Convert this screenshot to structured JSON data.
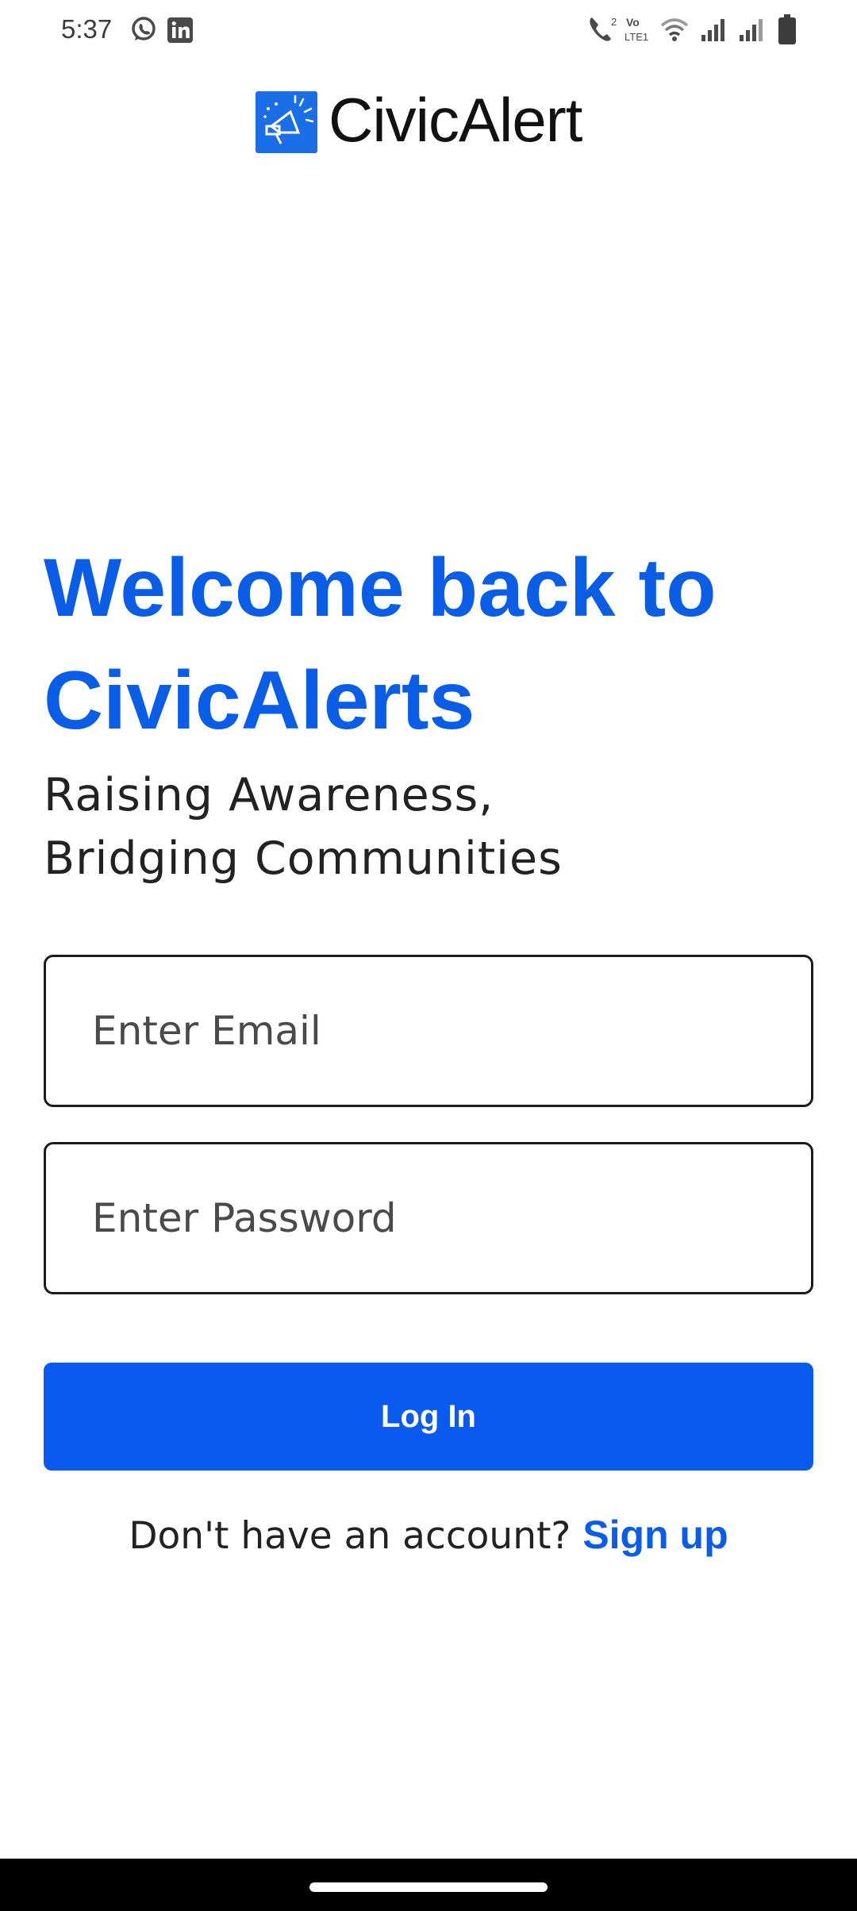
{
  "status_bar": {
    "time": "5:37",
    "network_label": "VoLTE1",
    "icons": [
      "whatsapp-icon",
      "linkedin-icon",
      "call-icon",
      "volte-icon",
      "wifi-icon",
      "signal-icon",
      "signal-icon",
      "battery-icon"
    ]
  },
  "header": {
    "app_name": "CivicAlert",
    "logo_icon": "megaphone-icon",
    "brand_color": "#1a6fe8"
  },
  "welcome": {
    "title": "Welcome back to CivicAlerts",
    "tagline_line1": "Raising Awareness,",
    "tagline_line2": "Bridging Communities"
  },
  "form": {
    "email_placeholder": "Enter Email",
    "email_value": "",
    "password_placeholder": "Enter Password",
    "password_value": "",
    "login_label": "Log In",
    "button_color": "#0a5af0"
  },
  "signup": {
    "prompt": "Don't have an account?",
    "link_label": "Sign up"
  }
}
